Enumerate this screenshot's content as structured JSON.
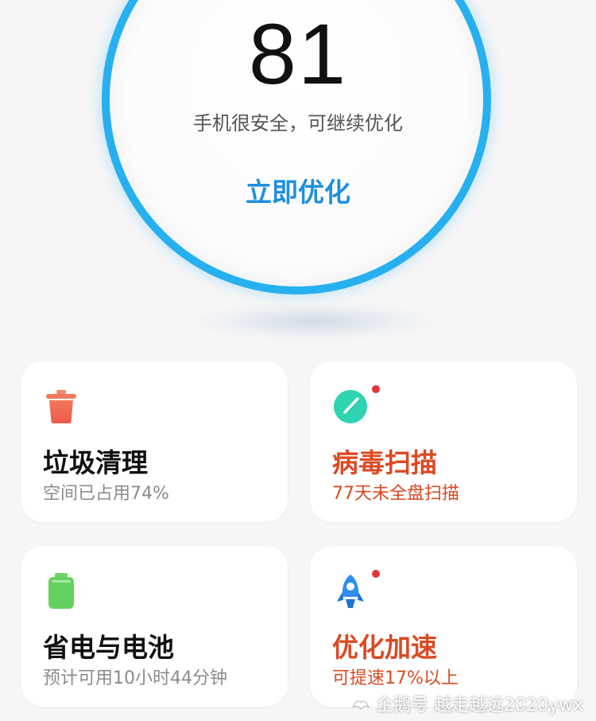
{
  "score": {
    "value": "81",
    "status_text": "手机很安全，可继续优化",
    "optimize_label": "立即优化",
    "ring_color": "#27b0ef"
  },
  "cards": [
    {
      "title": "垃圾清理",
      "subtitle": "空间已占用74%",
      "icon": "trash-icon",
      "warning": false
    },
    {
      "title": "病毒扫描",
      "subtitle": "77天未全盘扫描",
      "icon": "virus-scan-icon",
      "warning": true
    },
    {
      "title": "省电与电池",
      "subtitle": "预计可用10小时44分钟",
      "icon": "battery-icon",
      "warning": false
    },
    {
      "title": "优化加速",
      "subtitle": "可提速17%以上",
      "icon": "rocket-icon",
      "warning": true
    }
  ],
  "colors": {
    "warning": "#d94a23",
    "notification_dot": "#e4323a",
    "accent": "#1e8fe0"
  },
  "watermark": {
    "text": "企鹅号 越走越远2020ywx"
  }
}
